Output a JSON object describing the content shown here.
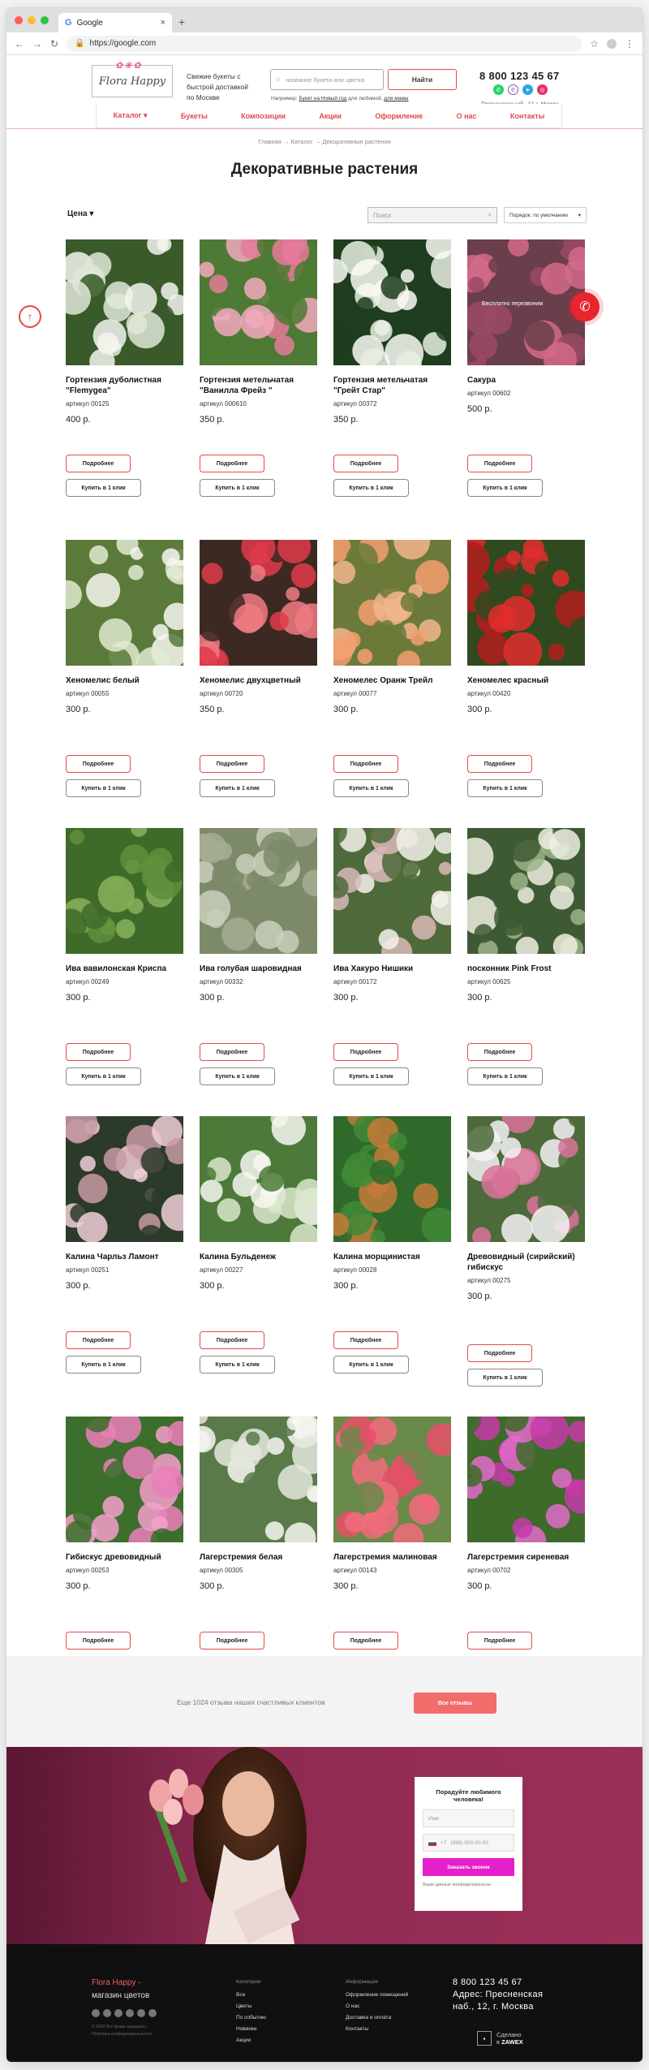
{
  "browser": {
    "tab_title": "Google",
    "url": "https://google.com"
  },
  "header": {
    "logo_text": "Flora Happy",
    "tagline": "Свежие букеты с быстрой доставкой по Москве",
    "search_placeholder": "название букета или цветка",
    "search_button": "Найти",
    "example_prefix": "Например:",
    "example_link1": "Букет на Новый год",
    "example_mid": "для любимой,",
    "example_link2": "для мамы",
    "phone": "8 800 123 45 67",
    "address": "Пресненская наб., 12, г. Москва"
  },
  "nav": [
    "Каталог",
    "Букеты",
    "Композиции",
    "Акции",
    "Оформление",
    "О нас",
    "Контакты"
  ],
  "breadcrumb": "Главная → Каталог → Декоративные растения",
  "page_title": "Декоративные растения",
  "filters": {
    "price_label": "Цена",
    "search_placeholder": "Поиск",
    "sort_label": "Порядок: по умолчанию"
  },
  "buttons": {
    "more": "Подробнее",
    "buy": "Купить в 1 клик",
    "callback_overlay": "Бесплатно перезвоним"
  },
  "products": [
    {
      "name": "Гортензия дуболистная \"Flemygea\"",
      "article": "артикул 00125",
      "price": "400 р."
    },
    {
      "name": "Гортензия метельчатая \"Ванилла Фрейз \"",
      "article": "артикул 000610",
      "price": "350 р."
    },
    {
      "name": "Гортензия метельчатая \"Грейт Стар\"",
      "article": "артикул 00372",
      "price": "350 р."
    },
    {
      "name": "Сакура",
      "article": "артикул 00602",
      "price": "500 р."
    },
    {
      "name": "Хеномелис белый",
      "article": "артикул 00055",
      "price": "300 р."
    },
    {
      "name": "Хеномелис двухцветный",
      "article": "артикул 00720",
      "price": "350 р."
    },
    {
      "name": "Хеномелес Оранж Трейл",
      "article": "артикул 00077",
      "price": "300 р."
    },
    {
      "name": "Хеномелес красный",
      "article": "артикул 00420",
      "price": "300 р."
    },
    {
      "name": "Ива вавилонская Криспа",
      "article": "артикул 00249",
      "price": "300 р."
    },
    {
      "name": "Ива голубая шаровидная",
      "article": "артикул 00332",
      "price": "300 р."
    },
    {
      "name": "Ива Хакуро Нишики",
      "article": "артикул 00172",
      "price": "300 р."
    },
    {
      "name": "посконник Pink Frost",
      "article": "артикул 00625",
      "price": "300 р."
    },
    {
      "name": "Калина Чарльз Ламонт",
      "article": "артикул 00251",
      "price": "300 р."
    },
    {
      "name": "Калина Бульденеж",
      "article": "артикул 00227",
      "price": "300 р."
    },
    {
      "name": "Калина морщинистая",
      "article": "артикул 00028",
      "price": "300 р."
    },
    {
      "name": "Древовидный (сирийский) гибискус",
      "article": "артикул 00275",
      "price": "300 р."
    },
    {
      "name": "Гибискус древовидный",
      "article": "артикул 00253",
      "price": "300 р."
    },
    {
      "name": "Лагерстремия белая",
      "article": "артикул 00305",
      "price": "300 р."
    },
    {
      "name": "Лагерстремия малиновая",
      "article": "артикул 00143",
      "price": "300 р."
    },
    {
      "name": "Лагерстремия сиреневая",
      "article": "артикул 00702",
      "price": "300 р."
    }
  ],
  "reviews": {
    "text": "Еще 1024 отзыва наших счастливых клиентов",
    "button": "Все отзывы"
  },
  "promo_form": {
    "title": "Порадуйте любимого человека!",
    "name_placeholder": "Имя",
    "phone_code": "+7",
    "phone_placeholder": "(999) 000-00-00",
    "submit": "Заказать звонок",
    "note": "Ваши данные конфиденциальны"
  },
  "footer": {
    "brand_pink": "Flora Happy -",
    "brand_rest": "магазин цветов",
    "copyright": "© 2019 Все права защищены",
    "policy": "Политика конфиденциальности",
    "col1_title": "Категории",
    "col1_items": [
      "Все",
      "Цветы",
      "По событию",
      "Новинки",
      "Акции"
    ],
    "col2_title": "Информация",
    "col2_items": [
      "Оформление помещений",
      "О нас",
      "Доставка и оплата",
      "Контакты"
    ],
    "phone": "8 800 123 45 67",
    "address1": "Адрес: Пресненская",
    "address2": "наб., 12, г. Москва",
    "dev_label1": "Сделано",
    "dev_label2": "в",
    "dev_name": "ZAWEX"
  },
  "colors": {
    "accent": "#e24b4b",
    "promo_bg": "#8d2a51",
    "submit": "#e51fc9",
    "footer_bg": "#101010"
  }
}
